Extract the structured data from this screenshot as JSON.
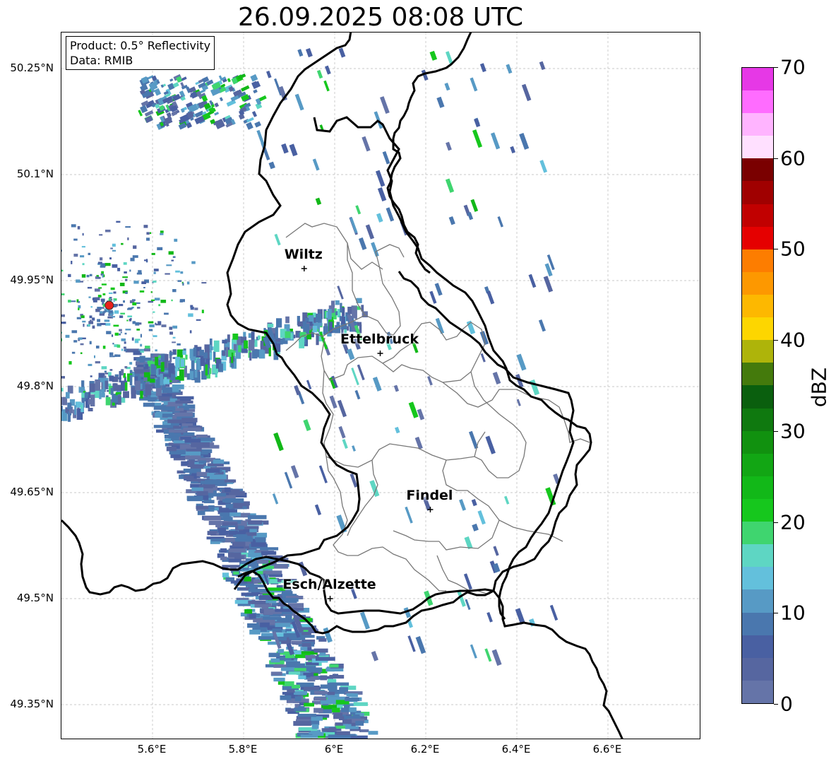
{
  "title": "26.09.2025 08:08 UTC",
  "info_box": {
    "product": "Product: 0.5° Reflectivity",
    "data_source": "Data: RMIB"
  },
  "axes": {
    "lat_ticks": [
      "50.25°N",
      "50.1°N",
      "49.95°N",
      "49.8°N",
      "49.65°N",
      "49.5°N",
      "49.35°N"
    ],
    "lon_ticks": [
      "5.6°E",
      "5.8°E",
      "6°E",
      "6.2°E",
      "6.4°E",
      "6.6°E"
    ],
    "lat_values": [
      50.25,
      50.1,
      49.95,
      49.8,
      49.65,
      49.5,
      49.35
    ],
    "lon_values": [
      5.6,
      5.8,
      6.0,
      6.2,
      6.4,
      6.6
    ],
    "lat_range": [
      49.3,
      50.3
    ],
    "lon_range": [
      5.4,
      6.8
    ],
    "grid": true
  },
  "cities": [
    {
      "name": "Wiltz",
      "lat": 49.967,
      "lon": 5.933
    },
    {
      "name": "Ettelbruck",
      "lat": 49.847,
      "lon": 6.1
    },
    {
      "name": "Findel",
      "lat": 49.626,
      "lon": 6.21
    },
    {
      "name": "Esch/Alzette",
      "lat": 49.5,
      "lon": 5.99
    }
  ],
  "radar_site": {
    "lat": 49.915,
    "lon": 5.505,
    "color": "#e8221c"
  },
  "colorbar": {
    "label": "dBZ",
    "min": 0,
    "max": 70,
    "tick_labels": [
      "0",
      "10",
      "20",
      "30",
      "40",
      "50",
      "60",
      "70"
    ],
    "colors": [
      "#6574a8",
      "#5666a0",
      "#4960a2",
      "#4a77ae",
      "#579ac5",
      "#63c0dc",
      "#5ed6c3",
      "#3fd56f",
      "#16c71d",
      "#12b818",
      "#12a614",
      "#11910f",
      "#0f790f",
      "#0a5f0e",
      "#447a0c",
      "#aeb40a",
      "#fdd600",
      "#fdb800",
      "#fd9800",
      "#fd7d00",
      "#e50000",
      "#c10000",
      "#a00000",
      "#7a0000",
      "#ffe0ff",
      "#ffb4ff",
      "#ff6cff",
      "#e638e6"
    ]
  }
}
